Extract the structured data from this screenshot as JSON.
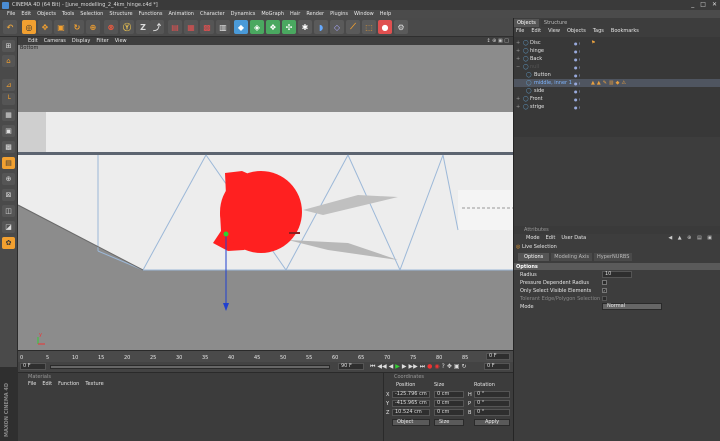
{
  "window": {
    "title": "CINEMA 4D (64 Bit) - [june_modelling_2_4km_hinge.c4d *]"
  },
  "menu": [
    "File",
    "Edit",
    "Objects",
    "Tools",
    "Selection",
    "Structure",
    "Functions",
    "Animation",
    "Character",
    "Dynamics",
    "MoGraph",
    "Hair",
    "Render",
    "Plugins",
    "Window",
    "Help"
  ],
  "viewport": {
    "menu": [
      "Edit",
      "Cameras",
      "Display",
      "Filter",
      "View"
    ],
    "camera_label": "Bottom",
    "grid_label": "Grid Spacing : 100 cm"
  },
  "timeline": {
    "ticks": [
      "0",
      "5",
      "10",
      "15",
      "20",
      "25",
      "30",
      "35",
      "40",
      "45",
      "50",
      "55",
      "60",
      "65",
      "70",
      "75",
      "80",
      "85",
      "90"
    ],
    "frame_value": "0 F",
    "start_field": "0 F",
    "end_field": "90 F",
    "current_field": "0 F"
  },
  "materials": {
    "title": "Materials",
    "menu": [
      "File",
      "Edit",
      "Function",
      "Texture"
    ]
  },
  "coordinates": {
    "title": "Coordinates",
    "headers": [
      "Position",
      "Size",
      "Rotation"
    ],
    "rows": [
      {
        "axis": "X",
        "pos": "-125.796 cm",
        "size": "0 cm",
        "rot_axis": "H",
        "rot": "0 °"
      },
      {
        "axis": "Y",
        "pos": "-415.965 cm",
        "size": "0 cm",
        "rot_axis": "P",
        "rot": "0 °"
      },
      {
        "axis": "Z",
        "pos": "10.524 cm",
        "size": "0 cm",
        "rot_axis": "B",
        "rot": "0 °"
      }
    ],
    "mode_object": "Object",
    "mode_size": "Size",
    "apply": "Apply"
  },
  "objects_panel": {
    "tabs": [
      "Objects",
      "Structure"
    ],
    "menu": [
      "File",
      "Edit",
      "View",
      "Objects",
      "Tags",
      "Bookmarks"
    ],
    "items": [
      {
        "name": "Disc",
        "indent": 0
      },
      {
        "name": "hinge",
        "indent": 0
      },
      {
        "name": "Back",
        "indent": 0
      },
      {
        "name": "null",
        "indent": 0
      },
      {
        "name": "Button",
        "indent": 1
      },
      {
        "name": "middle, inner 1",
        "indent": 1
      },
      {
        "name": "side",
        "indent": 1
      },
      {
        "name": "Front",
        "indent": 0
      },
      {
        "name": "strige",
        "indent": 0
      }
    ]
  },
  "attributes_panel": {
    "title": "Attributes",
    "menu": [
      "Mode",
      "Edit",
      "User Data"
    ],
    "tool_name": "Live Selection",
    "tabs": [
      "Options",
      "Modeling Axis",
      "HyperNURBS"
    ],
    "section": "Options",
    "radius_label": "Radius",
    "radius_value": "10",
    "pressure_label": "Pressure Dependent Radius",
    "only_visible_label": "Only Select Visible Elements",
    "tolerant_label": "Tolerant Edge/Polygon Selection",
    "mode_label": "Mode",
    "mode_value": "Normal"
  },
  "brand": "MAXON CINEMA 4D",
  "colors": {
    "sphere": "#ff2020",
    "viewport_bg": "#8c8c8c",
    "selection_accent": "#f2a030"
  }
}
